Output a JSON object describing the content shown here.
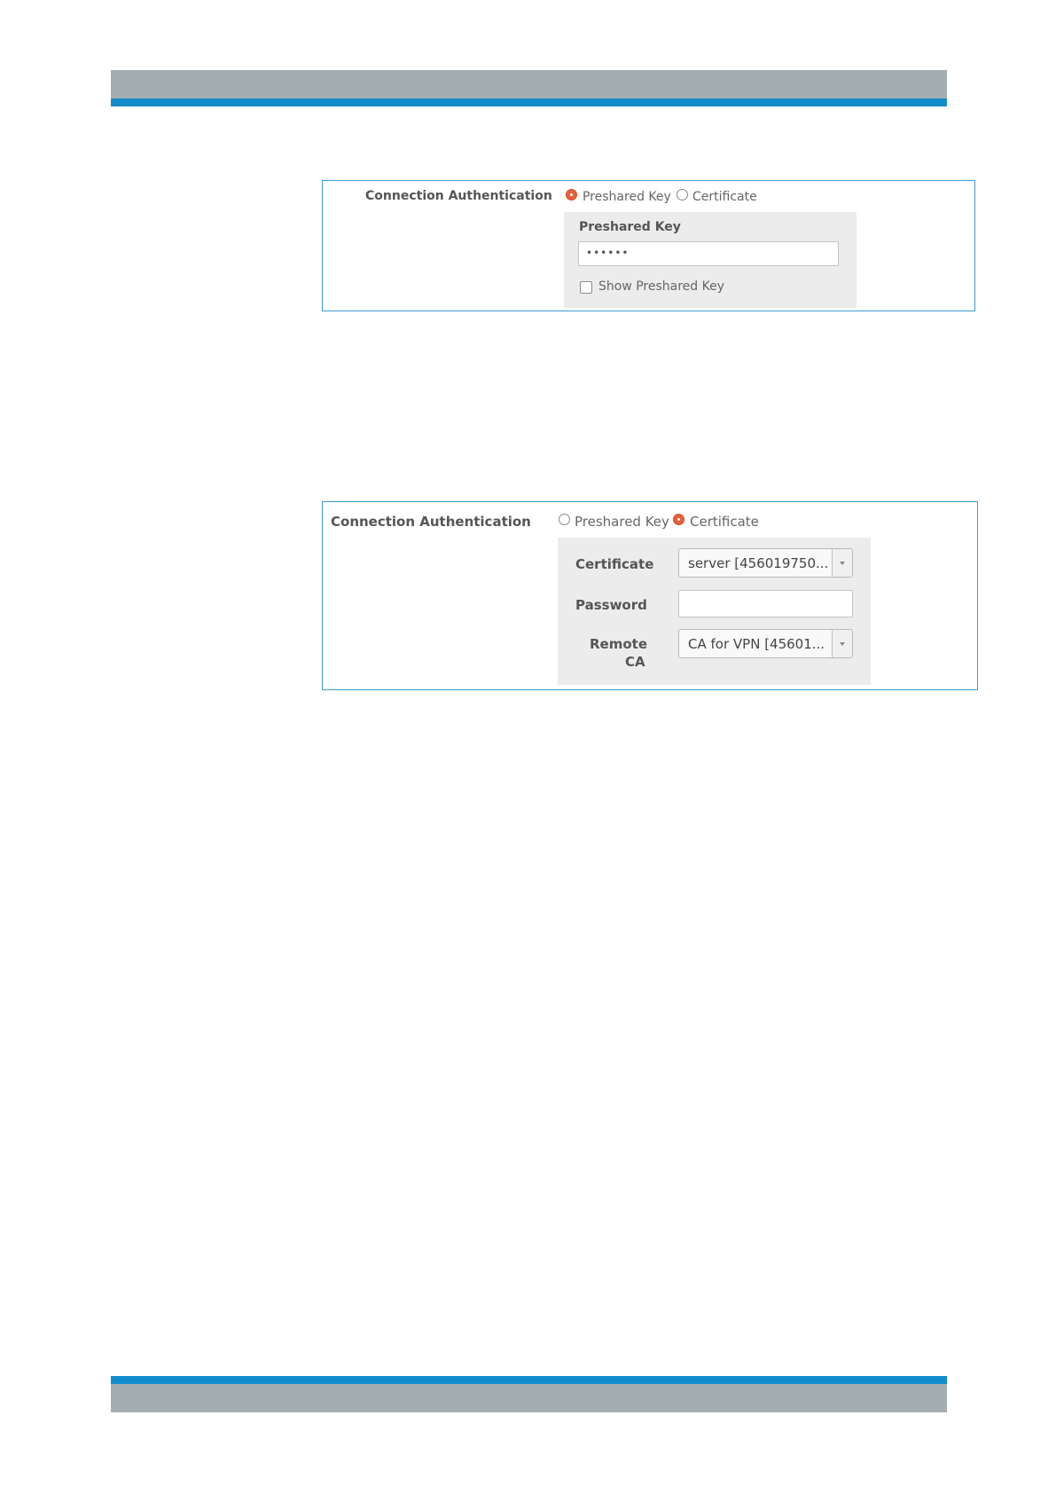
{
  "panel1": {
    "auth_label": "Connection Authentication",
    "option_preshared": "Preshared Key",
    "option_certificate": "Certificate",
    "selected": "preshared",
    "preshared_heading": "Preshared Key",
    "preshared_value": "••••••",
    "show_key_label": "Show Preshared Key",
    "show_key_checked": false
  },
  "panel2": {
    "auth_label": "Connection Authentication",
    "option_preshared": "Preshared Key",
    "option_certificate": "Certificate",
    "selected": "certificate",
    "certificate_label": "Certificate",
    "certificate_value": "server [456019750...",
    "password_label": "Password",
    "password_value": "",
    "remote_ca_label_line1": "Remote",
    "remote_ca_label_line2": "CA",
    "remote_ca_value": "CA for VPN [45601..."
  },
  "colors": {
    "accent_blue": "#138ccc",
    "band_gray": "#a4adb2",
    "radio_selected": "#e8613a",
    "panel_border": "#3e9bd6"
  }
}
